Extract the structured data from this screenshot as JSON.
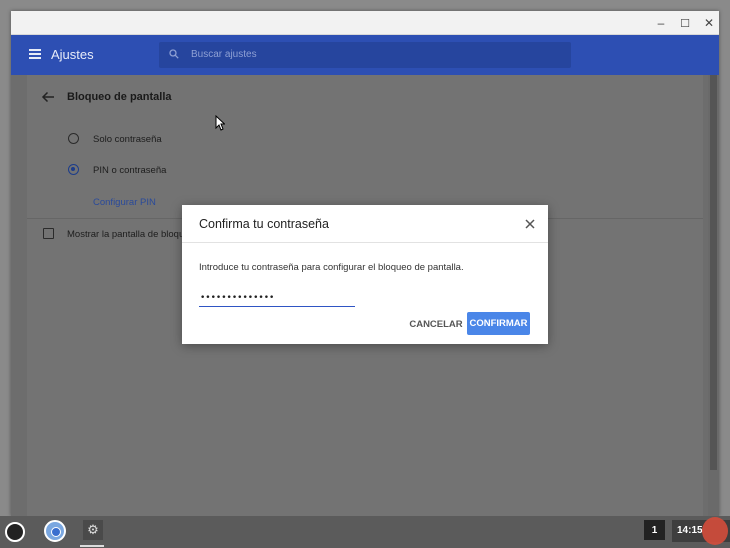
{
  "window": {
    "minimize": "–",
    "maximize": "☐",
    "close": "✕"
  },
  "appbar": {
    "title": "Ajustes",
    "search_placeholder": "Buscar ajustes"
  },
  "settings": {
    "section_title": "Bloqueo de pantalla",
    "options": [
      {
        "label": "Solo contraseña",
        "checked": false
      },
      {
        "label": "PIN o contraseña",
        "checked": true
      }
    ],
    "configure_pin": "Configurar PIN",
    "show_lock_screen": "Mostrar la pantalla de bloqueo"
  },
  "dialog": {
    "title": "Confirma tu contraseña",
    "message": "Introduce tu contraseña para configurar el bloqueo de pantalla.",
    "password_value": "••••••••••••••",
    "cancel": "CANCELAR",
    "confirm": "CONFIRMAR"
  },
  "shelf": {
    "notification_count": "1",
    "clock": "14:15"
  },
  "icons": {
    "menu": "menu-icon",
    "search": "search-icon",
    "back": "back-arrow-icon",
    "close": "close-icon",
    "launcher": "launcher-icon",
    "browser": "chrome-icon",
    "settings": "gear-icon"
  },
  "colors": {
    "appbar": "#2d4fb3",
    "accent": "#4a86e8",
    "underline": "#2f55c4"
  }
}
